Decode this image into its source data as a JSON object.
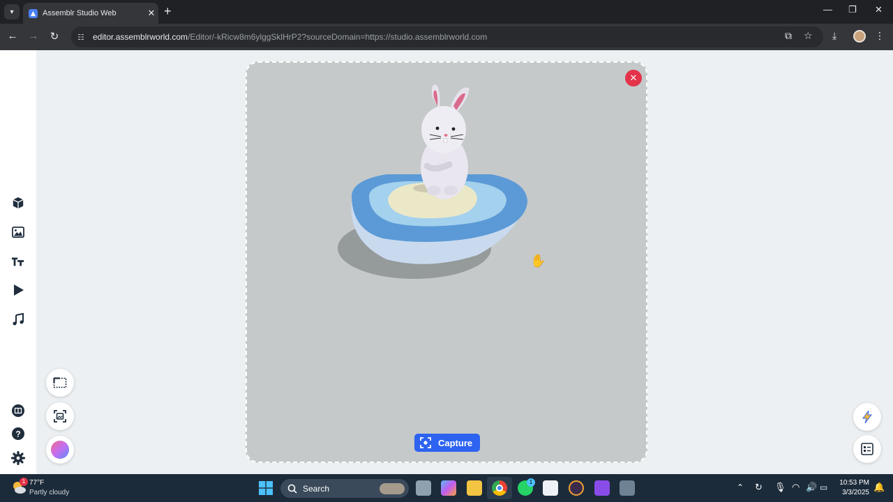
{
  "browser": {
    "tab_title": "Assemblr Studio Web",
    "url_host": "editor.assemblrworld.com",
    "url_rest": "/Editor/-kRicw8m6ylggSklHrP2?sourceDomain=https://studio.assemblrworld.com"
  },
  "sidebar": {
    "items": [
      {
        "name": "3d-objects",
        "icon": "cube-icon"
      },
      {
        "name": "images",
        "icon": "image-icon"
      },
      {
        "name": "text",
        "icon": "text-icon"
      },
      {
        "name": "animation",
        "icon": "play-icon"
      },
      {
        "name": "audio",
        "icon": "music-note-icon"
      }
    ],
    "bottom": [
      "guide-icon",
      "help-icon",
      "settings-icon"
    ]
  },
  "stage": {
    "capture_label": "Capture",
    "colors": {
      "close": "#e2334a",
      "capture": "#2d63f0",
      "stage_bg": "#c5c9ca"
    }
  },
  "taskbar": {
    "weather_temp": "77°F",
    "weather_desc": "Partly cloudy",
    "weather_badge": "1",
    "search_label": "Search",
    "whatsapp_badge": "1",
    "time": "10:53 PM",
    "date": "3/3/2025"
  }
}
